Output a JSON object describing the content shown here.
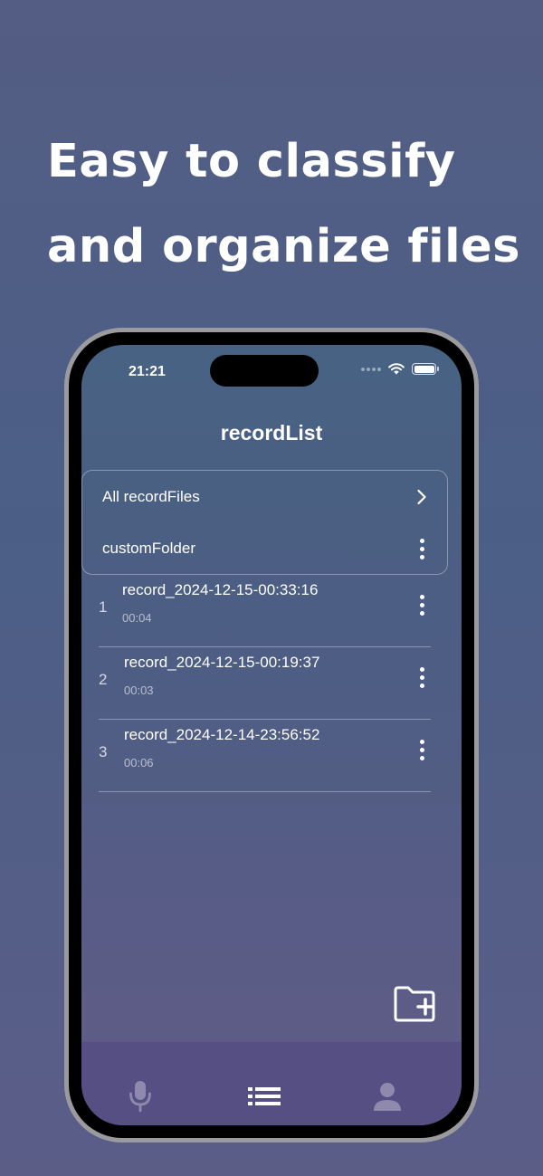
{
  "headline": {
    "line1": "Easy to classify",
    "line2": "and organize files"
  },
  "status_bar": {
    "time": "21:21"
  },
  "nav": {
    "title": "recordList"
  },
  "folders": [
    {
      "label": "All recordFiles",
      "icon": "chevron-right-icon"
    },
    {
      "label": "customFolder",
      "icon": "kebab-menu-icon"
    }
  ],
  "records": [
    {
      "index": "1",
      "name": "record_2024-12-15-00:33:16",
      "duration": "00:04"
    },
    {
      "index": "2",
      "name": "record_2024-12-15-00:19:37",
      "duration": "00:03"
    },
    {
      "index": "3",
      "name": "record_2024-12-14-23:56:52",
      "duration": "00:06"
    }
  ],
  "tabs": [
    {
      "icon": "microphone-icon",
      "active": false
    },
    {
      "icon": "list-icon",
      "active": true
    },
    {
      "icon": "person-icon",
      "active": false
    }
  ],
  "colors": {
    "background": "#4e5f86",
    "tab_bar": "#554f84",
    "text": "#ffffff"
  }
}
